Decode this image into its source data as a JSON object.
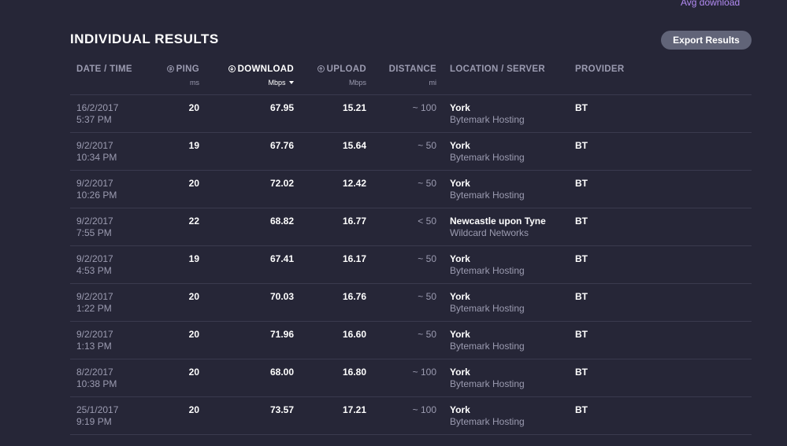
{
  "top_link": "Avg download",
  "title": "INDIVIDUAL RESULTS",
  "export_label": "Export Results",
  "headers": {
    "datetime": "DATE / TIME",
    "ping": "PING",
    "ping_unit": "ms",
    "download": "DOWNLOAD",
    "download_unit": "Mbps",
    "upload": "UPLOAD",
    "upload_unit": "Mbps",
    "distance": "DISTANCE",
    "distance_unit": "mi",
    "location": "LOCATION / SERVER",
    "provider": "PROVIDER"
  },
  "rows": [
    {
      "date": "16/2/2017",
      "time": "5:37 PM",
      "ping": "20",
      "download": "67.95",
      "upload": "15.21",
      "distance": "~ 100",
      "city": "York",
      "server": "Bytemark Hosting",
      "provider": "BT"
    },
    {
      "date": "9/2/2017",
      "time": "10:34 PM",
      "ping": "19",
      "download": "67.76",
      "upload": "15.64",
      "distance": "~ 50",
      "city": "York",
      "server": "Bytemark Hosting",
      "provider": "BT"
    },
    {
      "date": "9/2/2017",
      "time": "10:26 PM",
      "ping": "20",
      "download": "72.02",
      "upload": "12.42",
      "distance": "~ 50",
      "city": "York",
      "server": "Bytemark Hosting",
      "provider": "BT"
    },
    {
      "date": "9/2/2017",
      "time": "7:55 PM",
      "ping": "22",
      "download": "68.82",
      "upload": "16.77",
      "distance": "< 50",
      "city": "Newcastle upon Tyne",
      "server": "Wildcard Networks",
      "provider": "BT"
    },
    {
      "date": "9/2/2017",
      "time": "4:53 PM",
      "ping": "19",
      "download": "67.41",
      "upload": "16.17",
      "distance": "~ 50",
      "city": "York",
      "server": "Bytemark Hosting",
      "provider": "BT"
    },
    {
      "date": "9/2/2017",
      "time": "1:22 PM",
      "ping": "20",
      "download": "70.03",
      "upload": "16.76",
      "distance": "~ 50",
      "city": "York",
      "server": "Bytemark Hosting",
      "provider": "BT"
    },
    {
      "date": "9/2/2017",
      "time": "1:13 PM",
      "ping": "20",
      "download": "71.96",
      "upload": "16.60",
      "distance": "~ 50",
      "city": "York",
      "server": "Bytemark Hosting",
      "provider": "BT"
    },
    {
      "date": "8/2/2017",
      "time": "10:38 PM",
      "ping": "20",
      "download": "68.00",
      "upload": "16.80",
      "distance": "~ 100",
      "city": "York",
      "server": "Bytemark Hosting",
      "provider": "BT"
    },
    {
      "date": "25/1/2017",
      "time": "9:19 PM",
      "ping": "20",
      "download": "73.57",
      "upload": "17.21",
      "distance": "~ 100",
      "city": "York",
      "server": "Bytemark Hosting",
      "provider": "BT"
    }
  ],
  "colors": {
    "background": "#262637",
    "accent_link": "#b48cf5",
    "muted_text": "#9b9bb0",
    "button_bg": "#616478"
  },
  "icons": {
    "ping": "ping-icon",
    "download": "download-icon",
    "upload": "upload-icon",
    "sort": "sort-down-caret-icon"
  }
}
